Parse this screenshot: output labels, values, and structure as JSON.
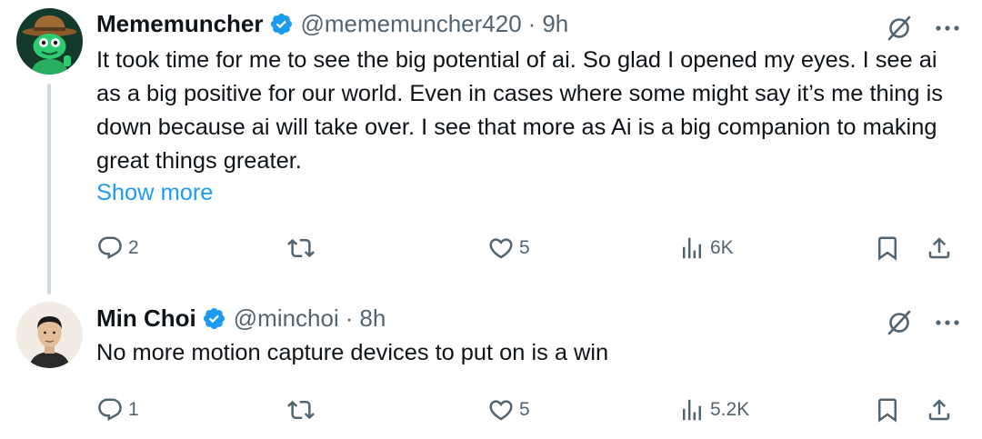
{
  "tweets": [
    {
      "name": "Mememuncher",
      "handle": "@mememuncher420",
      "time": "9h",
      "text": "It took time for me to see the big potential of ai. So glad I opened my eyes. I see ai as a big positive for our world. Even in cases where some might say it’s me thing is down because ai will take over. I see that more as Ai is a big companion to making great things greater.",
      "show_more": "Show more",
      "replies": "2",
      "likes": "5",
      "views": "6K"
    },
    {
      "name": "Min Choi",
      "handle": "@minchoi",
      "time": "8h",
      "text": "No more motion capture devices to put on is a win",
      "replies": "1",
      "likes": "5",
      "views": "5.2K"
    }
  ],
  "separator": "·",
  "icons": {
    "verified": "verified-badge-icon",
    "grok": "grok-icon",
    "more": "more-icon",
    "reply": "reply-icon",
    "repost": "repost-icon",
    "like": "like-icon",
    "views": "views-icon",
    "bookmark": "bookmark-icon",
    "share": "share-icon"
  },
  "colors": {
    "text": "#0f1419",
    "secondary": "#536471",
    "link": "#1d9bf0",
    "verified": "#1d9bf0",
    "thread_line": "#cfd9de"
  }
}
